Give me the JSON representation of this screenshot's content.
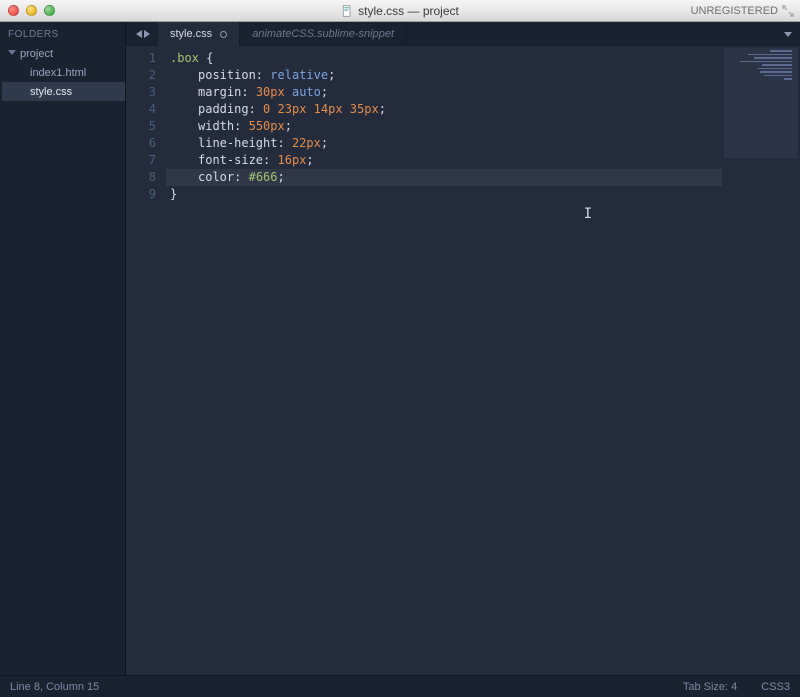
{
  "titlebar": {
    "title": "style.css — project",
    "unregistered": "UNREGISTERED"
  },
  "sidebar": {
    "header": "FOLDERS",
    "items": [
      {
        "label": "project",
        "kind": "folder",
        "expanded": true
      },
      {
        "label": "index1.html",
        "kind": "file",
        "selected": false
      },
      {
        "label": "style.css",
        "kind": "file",
        "selected": true
      }
    ]
  },
  "tabs": {
    "items": [
      {
        "label": "style.css",
        "active": true,
        "dirty": true
      },
      {
        "label": "animateCSS.sublime-snippet",
        "active": false,
        "dirty": false
      }
    ]
  },
  "editor": {
    "filename": "style.css",
    "language": "CSS3",
    "line_count": 9,
    "active_line": 8,
    "code_lines": [
      ".box {",
      "    position: relative;",
      "    margin: 30px auto;",
      "    padding: 0 23px 14px 35px;",
      "    width: 550px;",
      "    line-height: 22px;",
      "    font-size: 16px;",
      "    color: #666;",
      "}"
    ],
    "tokens": {
      "l1": {
        "sel": ".box",
        "open": " {"
      },
      "l2": {
        "prop": "position",
        "vals": [
          "relative"
        ]
      },
      "l3": {
        "prop": "margin",
        "nums": [
          "30px"
        ],
        "kw": "auto"
      },
      "l4": {
        "prop": "padding",
        "nums": [
          "0",
          "23px",
          "14px",
          "35px"
        ]
      },
      "l5": {
        "prop": "width",
        "nums": [
          "550px"
        ]
      },
      "l6": {
        "prop": "line-height",
        "nums": [
          "22px"
        ]
      },
      "l7": {
        "prop": "font-size",
        "nums": [
          "16px"
        ]
      },
      "l8": {
        "prop": "color",
        "str": "#666"
      },
      "l9": {
        "close": "}"
      }
    },
    "colon": ":",
    "semi": ";",
    "space": " "
  },
  "status": {
    "left": "Line 8, Column 15",
    "tab_size": "Tab Size: 4",
    "syntax": "CSS3"
  }
}
